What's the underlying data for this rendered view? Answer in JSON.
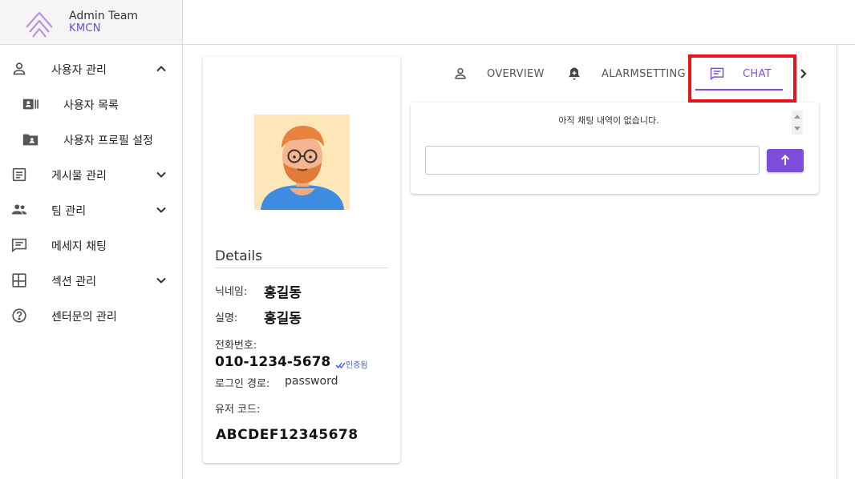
{
  "brand": {
    "title": "Admin Team",
    "subtitle": "KMCN",
    "accent": "#7a4fe0",
    "logo_color": "#b792e6"
  },
  "sidebar": {
    "items": [
      {
        "label": "사용자 관리",
        "icon": "person-icon",
        "expanded": true
      },
      {
        "label": "사용자 목록",
        "icon": "badge-icon"
      },
      {
        "label": "사용자 프로필 설정",
        "icon": "folder-shared-icon"
      },
      {
        "label": "게시물 관리",
        "icon": "article-icon",
        "expanded": false
      },
      {
        "label": "팀 관리",
        "icon": "people-icon",
        "expanded": false
      },
      {
        "label": "메세지 채팅",
        "icon": "chat-icon"
      },
      {
        "label": "섹션 관리",
        "icon": "dashboard-icon",
        "expanded": false
      },
      {
        "label": "센터문의 관리",
        "icon": "help-icon"
      }
    ]
  },
  "profile": {
    "details_title": "Details",
    "nickname_label": "닉네임:",
    "nickname": "홍길동",
    "realname_label": "실명:",
    "realname": "홍길동",
    "phone_label": "전화번호:",
    "phone": "010-1234-5678",
    "verified": "인증됨",
    "login_label": "로그인 경로:",
    "login": "password",
    "usercode_label": "유저 코드:",
    "usercode": "ABCDEF12345678"
  },
  "tabs": [
    {
      "label": "OVERVIEW",
      "icon": "person-outline-icon"
    },
    {
      "label": "ALARMSETTING",
      "icon": "notification-add-icon"
    },
    {
      "label": "CHAT",
      "icon": "chat-icon",
      "active": true
    }
  ],
  "chat": {
    "empty_message": "아직 채팅 내역이 없습니다.",
    "input_value": "",
    "input_placeholder": "",
    "send_color": "#7c4ddb"
  },
  "highlight_color": "#e8141a"
}
